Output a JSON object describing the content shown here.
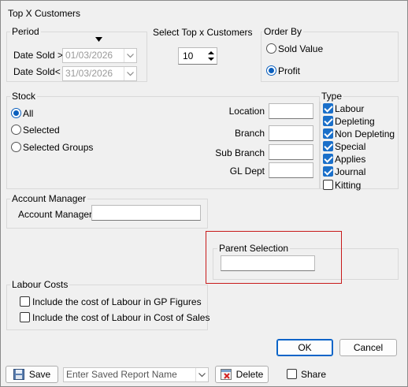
{
  "window": {
    "title": "Top X Customers"
  },
  "period": {
    "label": "Period",
    "date_from_label": "Date Sold >",
    "date_from": "01/03/2026",
    "date_to_label": "Date Sold<",
    "date_to": "31/03/2026"
  },
  "topx": {
    "label": "Select Top x Customers",
    "value": "10"
  },
  "order_by": {
    "label": "Order By",
    "options": [
      "Sold Value",
      "Profit"
    ],
    "selected": "Profit"
  },
  "stock": {
    "label": "Stock",
    "options": [
      "All",
      "Selected",
      "Selected Groups"
    ],
    "selected": "All",
    "fields": [
      {
        "label": "Location",
        "value": ""
      },
      {
        "label": "Branch",
        "value": ""
      },
      {
        "label": "Sub Branch",
        "value": ""
      },
      {
        "label": "GL Dept",
        "value": ""
      }
    ]
  },
  "type": {
    "label": "Type",
    "items": [
      {
        "label": "Labour",
        "checked": true
      },
      {
        "label": "Depleting",
        "checked": true
      },
      {
        "label": "Non Depleting",
        "checked": true
      },
      {
        "label": "Special",
        "checked": true
      },
      {
        "label": "Applies",
        "checked": true
      },
      {
        "label": "Journal",
        "checked": true
      },
      {
        "label": "Kitting",
        "checked": false
      }
    ]
  },
  "account_manager": {
    "group_label": "Account Manager",
    "label": "Account Manager",
    "value": ""
  },
  "parent_selection": {
    "label": "Parent Selection",
    "value": "",
    "highlight_color": "#c81a1a"
  },
  "labour_costs": {
    "label": "Labour Costs",
    "items": [
      {
        "label": "Include the cost of Labour in GP Figures",
        "checked": false
      },
      {
        "label": "Include the cost of Labour in Cost of Sales",
        "checked": false
      }
    ]
  },
  "buttons": {
    "ok": "OK",
    "cancel": "Cancel",
    "save": "Save",
    "delete": "Delete"
  },
  "saved_report": {
    "placeholder": "Enter Saved Report Name"
  },
  "share": {
    "label": "Share",
    "checked": false
  },
  "icons": {
    "save": "floppy-disk-icon",
    "delete": "delete-report-icon"
  }
}
